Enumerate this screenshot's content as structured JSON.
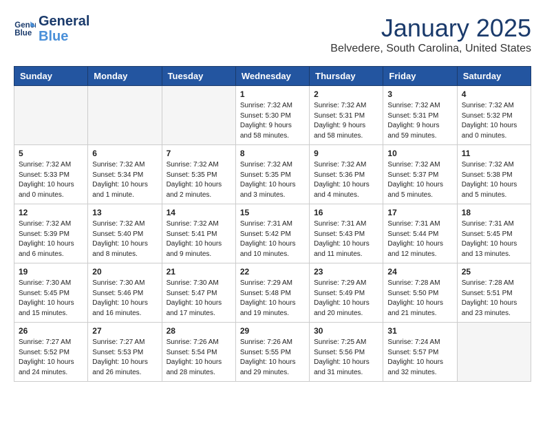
{
  "header": {
    "logo_line1": "General",
    "logo_line2": "Blue",
    "month": "January 2025",
    "location": "Belvedere, South Carolina, United States"
  },
  "weekdays": [
    "Sunday",
    "Monday",
    "Tuesday",
    "Wednesday",
    "Thursday",
    "Friday",
    "Saturday"
  ],
  "weeks": [
    [
      {
        "day": "",
        "info": ""
      },
      {
        "day": "",
        "info": ""
      },
      {
        "day": "",
        "info": ""
      },
      {
        "day": "1",
        "info": "Sunrise: 7:32 AM\nSunset: 5:30 PM\nDaylight: 9 hours\nand 58 minutes."
      },
      {
        "day": "2",
        "info": "Sunrise: 7:32 AM\nSunset: 5:31 PM\nDaylight: 9 hours\nand 58 minutes."
      },
      {
        "day": "3",
        "info": "Sunrise: 7:32 AM\nSunset: 5:31 PM\nDaylight: 9 hours\nand 59 minutes."
      },
      {
        "day": "4",
        "info": "Sunrise: 7:32 AM\nSunset: 5:32 PM\nDaylight: 10 hours\nand 0 minutes."
      }
    ],
    [
      {
        "day": "5",
        "info": "Sunrise: 7:32 AM\nSunset: 5:33 PM\nDaylight: 10 hours\nand 0 minutes."
      },
      {
        "day": "6",
        "info": "Sunrise: 7:32 AM\nSunset: 5:34 PM\nDaylight: 10 hours\nand 1 minute."
      },
      {
        "day": "7",
        "info": "Sunrise: 7:32 AM\nSunset: 5:35 PM\nDaylight: 10 hours\nand 2 minutes."
      },
      {
        "day": "8",
        "info": "Sunrise: 7:32 AM\nSunset: 5:35 PM\nDaylight: 10 hours\nand 3 minutes."
      },
      {
        "day": "9",
        "info": "Sunrise: 7:32 AM\nSunset: 5:36 PM\nDaylight: 10 hours\nand 4 minutes."
      },
      {
        "day": "10",
        "info": "Sunrise: 7:32 AM\nSunset: 5:37 PM\nDaylight: 10 hours\nand 5 minutes."
      },
      {
        "day": "11",
        "info": "Sunrise: 7:32 AM\nSunset: 5:38 PM\nDaylight: 10 hours\nand 5 minutes."
      }
    ],
    [
      {
        "day": "12",
        "info": "Sunrise: 7:32 AM\nSunset: 5:39 PM\nDaylight: 10 hours\nand 6 minutes."
      },
      {
        "day": "13",
        "info": "Sunrise: 7:32 AM\nSunset: 5:40 PM\nDaylight: 10 hours\nand 8 minutes."
      },
      {
        "day": "14",
        "info": "Sunrise: 7:32 AM\nSunset: 5:41 PM\nDaylight: 10 hours\nand 9 minutes."
      },
      {
        "day": "15",
        "info": "Sunrise: 7:31 AM\nSunset: 5:42 PM\nDaylight: 10 hours\nand 10 minutes."
      },
      {
        "day": "16",
        "info": "Sunrise: 7:31 AM\nSunset: 5:43 PM\nDaylight: 10 hours\nand 11 minutes."
      },
      {
        "day": "17",
        "info": "Sunrise: 7:31 AM\nSunset: 5:44 PM\nDaylight: 10 hours\nand 12 minutes."
      },
      {
        "day": "18",
        "info": "Sunrise: 7:31 AM\nSunset: 5:45 PM\nDaylight: 10 hours\nand 13 minutes."
      }
    ],
    [
      {
        "day": "19",
        "info": "Sunrise: 7:30 AM\nSunset: 5:45 PM\nDaylight: 10 hours\nand 15 minutes."
      },
      {
        "day": "20",
        "info": "Sunrise: 7:30 AM\nSunset: 5:46 PM\nDaylight: 10 hours\nand 16 minutes."
      },
      {
        "day": "21",
        "info": "Sunrise: 7:30 AM\nSunset: 5:47 PM\nDaylight: 10 hours\nand 17 minutes."
      },
      {
        "day": "22",
        "info": "Sunrise: 7:29 AM\nSunset: 5:48 PM\nDaylight: 10 hours\nand 19 minutes."
      },
      {
        "day": "23",
        "info": "Sunrise: 7:29 AM\nSunset: 5:49 PM\nDaylight: 10 hours\nand 20 minutes."
      },
      {
        "day": "24",
        "info": "Sunrise: 7:28 AM\nSunset: 5:50 PM\nDaylight: 10 hours\nand 21 minutes."
      },
      {
        "day": "25",
        "info": "Sunrise: 7:28 AM\nSunset: 5:51 PM\nDaylight: 10 hours\nand 23 minutes."
      }
    ],
    [
      {
        "day": "26",
        "info": "Sunrise: 7:27 AM\nSunset: 5:52 PM\nDaylight: 10 hours\nand 24 minutes."
      },
      {
        "day": "27",
        "info": "Sunrise: 7:27 AM\nSunset: 5:53 PM\nDaylight: 10 hours\nand 26 minutes."
      },
      {
        "day": "28",
        "info": "Sunrise: 7:26 AM\nSunset: 5:54 PM\nDaylight: 10 hours\nand 28 minutes."
      },
      {
        "day": "29",
        "info": "Sunrise: 7:26 AM\nSunset: 5:55 PM\nDaylight: 10 hours\nand 29 minutes."
      },
      {
        "day": "30",
        "info": "Sunrise: 7:25 AM\nSunset: 5:56 PM\nDaylight: 10 hours\nand 31 minutes."
      },
      {
        "day": "31",
        "info": "Sunrise: 7:24 AM\nSunset: 5:57 PM\nDaylight: 10 hours\nand 32 minutes."
      },
      {
        "day": "",
        "info": ""
      }
    ]
  ]
}
